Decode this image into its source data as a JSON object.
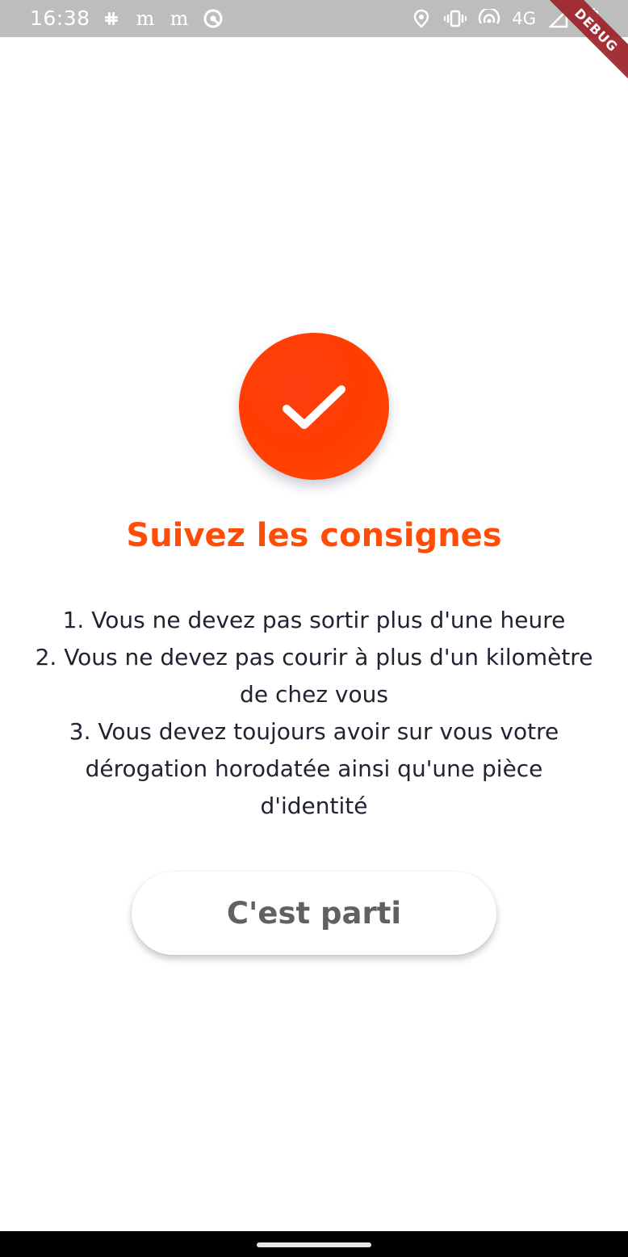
{
  "status_bar": {
    "time": "16:38",
    "left_icons": [
      "slack-icon",
      "gmail-icon",
      "gmail-icon",
      "vpn-icon"
    ],
    "network_label": "4G",
    "right_icons": [
      "location-icon",
      "vibrate-icon",
      "hotspot-icon",
      "signal-icon",
      "battery-icon"
    ],
    "bg_color": "#bdbdbd"
  },
  "debug_banner": {
    "label": "DEBUG"
  },
  "check": {
    "icon": "check-icon",
    "color": "#ff3d00"
  },
  "title": "Suivez les consignes",
  "instructions": [
    "1. Vous ne devez pas sortir plus d'une heure",
    "2. Vous ne devez pas courir à plus d'un kilomètre de chez vous",
    "3. Vous devez toujours avoir sur vous votre dérogation horodatée ainsi qu'une pièce d'identité"
  ],
  "start_button": {
    "label": "C'est parti"
  },
  "colors": {
    "accent": "#ff4d08",
    "text": "#222233",
    "button_text": "#616161"
  }
}
